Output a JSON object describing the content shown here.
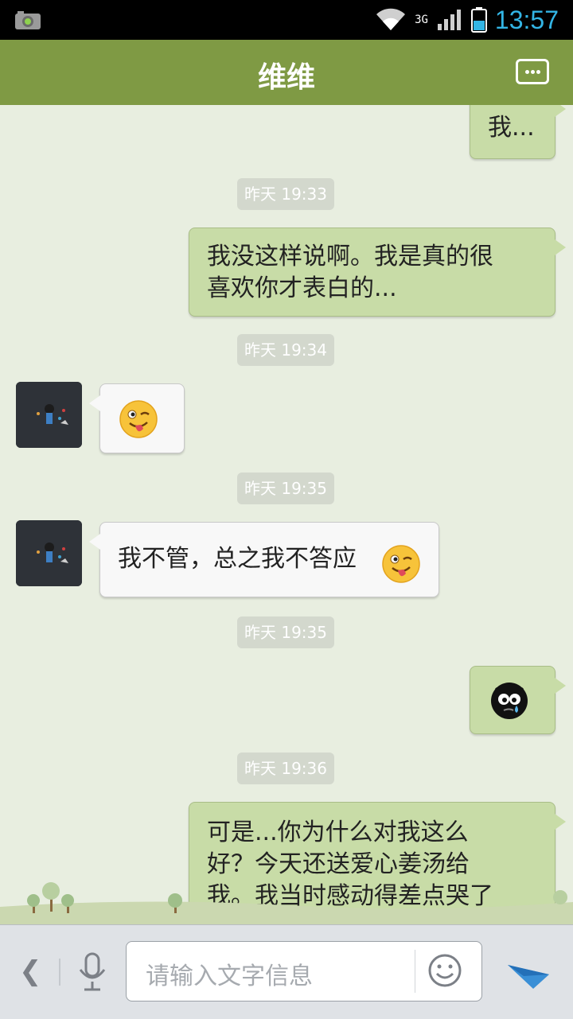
{
  "status_bar": {
    "time": "13:57",
    "network": "3G",
    "carrier_type": "G"
  },
  "header": {
    "title": "维维"
  },
  "messages": [
    {
      "side": "right",
      "text": "我..."
    },
    {
      "timestamp": "昨天 19:33"
    },
    {
      "side": "right",
      "text_line1": "我没这样说啊。我是真的很",
      "text_line2": "喜欢你才表白的..."
    },
    {
      "timestamp": "昨天 19:34"
    },
    {
      "side": "left",
      "emoji": "tongue-wink"
    },
    {
      "timestamp": "昨天 19:35"
    },
    {
      "side": "left",
      "text": "我不管，总之我不答应"
    },
    {
      "timestamp": "昨天 19:35"
    },
    {
      "side": "right",
      "emoji": "crying-black-face"
    },
    {
      "timestamp": "昨天 19:36"
    },
    {
      "side": "right",
      "text_line1": "可是...你为什么对我这么",
      "text_line2": "好？今天还送爱心姜汤给",
      "text_line3": "我。我当时感动得差点哭了"
    }
  ],
  "input_bar": {
    "placeholder": "请输入文字信息",
    "back_glyph": "❮"
  },
  "colors": {
    "title_bar": "#7f9a44",
    "chat_bg": "#e8eee0",
    "bubble_right": "#c8dca7",
    "bubble_left": "#f8f8f8",
    "time_accent": "#33b5e5",
    "send_icon": "#3a8fd6"
  }
}
